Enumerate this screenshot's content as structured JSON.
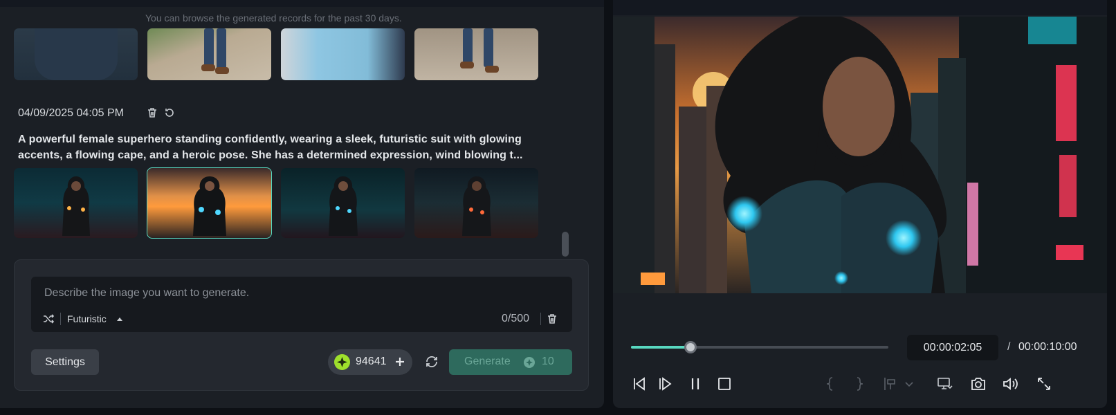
{
  "history": {
    "notice": "You can browse the generated records for the past 30 days.",
    "record": {
      "date": "04/09/2025 04:05 PM",
      "prompt": "A powerful female superhero standing confidently, wearing a sleek, futuristic suit with glowing accents, a flowing cape, and a heroic pose. She has a determined expression, wind blowing t..."
    },
    "selected_index": 1
  },
  "composer": {
    "placeholder": "Describe the image you want to generate.",
    "style": "Futuristic",
    "char_count": "0/500",
    "settings_label": "Settings",
    "credits": "94641",
    "generate_label": "Generate",
    "generate_cost": "10"
  },
  "player": {
    "current_time": "00:00:02:05",
    "separator": "/",
    "total_time": "00:00:10:00",
    "progress": 0.23
  },
  "colors": {
    "accent": "#58d8c0",
    "generate_bg": "#2e6a5d",
    "credit_coin": "#9ee02c"
  }
}
